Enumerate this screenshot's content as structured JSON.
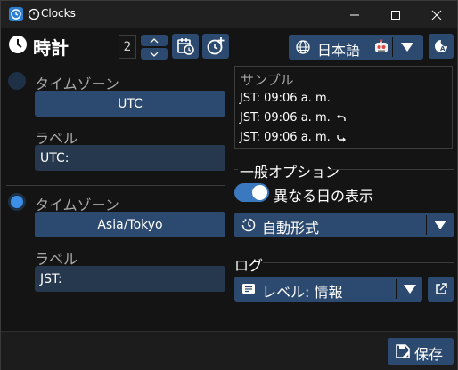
{
  "window": {
    "title": "Clocks",
    "controls": {
      "minimize": "minimize-icon",
      "maximize": "maximize-icon",
      "close": "close-icon"
    }
  },
  "header": {
    "title": "時計",
    "clock_count": "2",
    "language": "日本語"
  },
  "clocks": [
    {
      "timezone_label": "タイムゾーン",
      "timezone": "UTC",
      "label_label": "ラベル",
      "label_value": "UTC:",
      "selected": false
    },
    {
      "timezone_label": "タイムゾーン",
      "timezone": "Asia/Tokyo",
      "label_label": "ラベル",
      "label_value": "JST:",
      "selected": true
    }
  ],
  "sample": {
    "title": "サンプル",
    "lines": [
      "JST: 09:06 a. m.",
      "JST: 09:06 a. m.",
      "JST: 09:06 a. m."
    ],
    "line_icons": [
      "",
      "arrow-back-icon",
      "arrow-forward-icon"
    ]
  },
  "general": {
    "title": "一般オプション",
    "show_different_day_label": "異なる日の表示",
    "show_different_day_on": true,
    "format_label": "自動形式"
  },
  "log": {
    "title": "ログ",
    "level_label": "レベル: 情報"
  },
  "footer": {
    "save_label": "保存"
  },
  "colors": {
    "accent": "#2c4a6f",
    "input_bg": "#26384e",
    "toggle_on": "#3a78c0",
    "radio_selected": "#3d8fe8",
    "radio_unselected": "#1e3045"
  }
}
